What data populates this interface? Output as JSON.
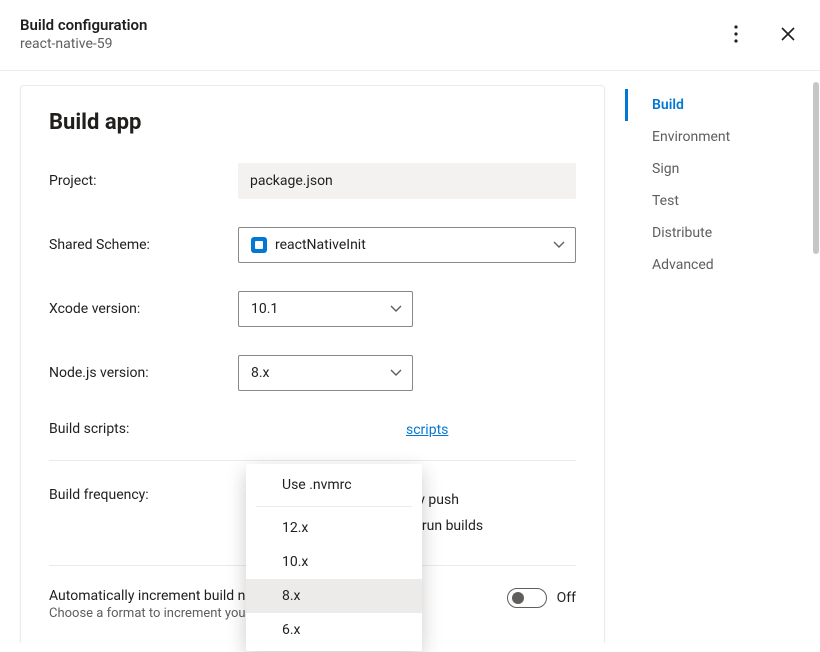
{
  "header": {
    "title": "Build configuration",
    "subtitle": "react-native-59"
  },
  "card": {
    "title": "Build app",
    "project": {
      "label": "Project:",
      "value": "package.json"
    },
    "scheme": {
      "label": "Shared Scheme:",
      "value": "reactNativeInit"
    },
    "xcode": {
      "label": "Xcode version:",
      "value": "10.1"
    },
    "node": {
      "label": "Node.js version:",
      "value": "8.x"
    },
    "scripts": {
      "label": "Build scripts:",
      "link": "scripts"
    },
    "frequency": {
      "label": "Build frequency:",
      "opt1_suffix": "ery push",
      "opt2_suffix": "to run builds"
    },
    "auto": {
      "title": "Automatically increment build number",
      "hint": "Choose a format to increment your builds.",
      "state": "Off"
    }
  },
  "nodeDropdown": {
    "top": "Use .nvmrc",
    "options": [
      "12.x",
      "10.x",
      "8.x",
      "6.x"
    ],
    "selected": "8.x"
  },
  "sidebar": {
    "items": [
      "Build",
      "Environment",
      "Sign",
      "Test",
      "Distribute",
      "Advanced"
    ],
    "active": "Build"
  }
}
